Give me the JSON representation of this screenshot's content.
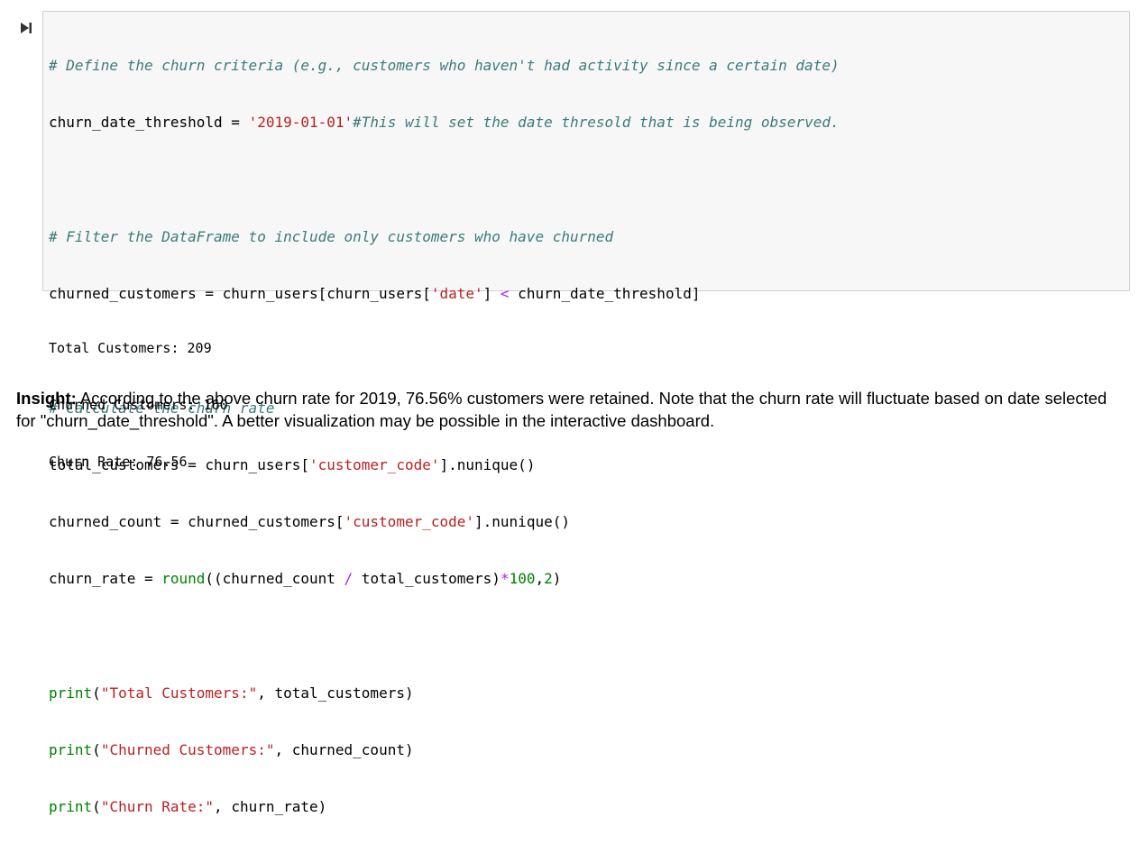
{
  "cell": {
    "run_icon": "step-forward-icon",
    "code": [
      [
        "# Define the churn criteria (e.g., customers who haven't had activity since a certain date)"
      ],
      [
        "churn_date_threshold = ",
        "'2019-01-01'",
        "#This will set the date thresold that is being observed."
      ],
      [],
      [
        "# Filter the DataFrame to include only customers who have churned"
      ],
      [
        "churned_customers = churn_users[churn_users[",
        "'date'",
        "] ",
        "<",
        " churn_date_threshold]"
      ],
      [],
      [
        "# Calculate the churn rate"
      ],
      [
        "total_customers = churn_users[",
        "'customer_code'",
        "].nunique()"
      ],
      [
        "churned_count = churned_customers[",
        "'customer_code'",
        "].nunique()"
      ],
      [
        "churn_rate = ",
        "round",
        "((churned_count ",
        "/",
        " total_customers)",
        "*",
        "100",
        ",",
        "2",
        ")"
      ],
      [],
      [
        "print",
        "(",
        "\"Total Customers:\"",
        ", total_customers)"
      ],
      [
        "print",
        "(",
        "\"Churned Customers:\"",
        ", churned_count)"
      ],
      [
        "print",
        "(",
        "\"Churn Rate:\"",
        ", churn_rate)"
      ]
    ]
  },
  "output": {
    "lines": [
      "Total Customers: 209",
      "Churned Customers: 160",
      "Churn Rate: 76.56"
    ]
  },
  "insight": {
    "label": "Insight:",
    "text": " According to the above churn rate for 2019, 76.56% customers were retained. Note that the churn rate will fluctuate based on date selected for \"churn_date_threshold\". A better visualization may be possible in the interactive dashboard."
  },
  "colors": {
    "comment": "#3d7a7a",
    "string": "#ba2121",
    "number": "#008000",
    "operator": "#aa22ff",
    "builtin": "#008000",
    "cell_background": "#f7f7f7",
    "cell_border": "#cfcfcf"
  }
}
